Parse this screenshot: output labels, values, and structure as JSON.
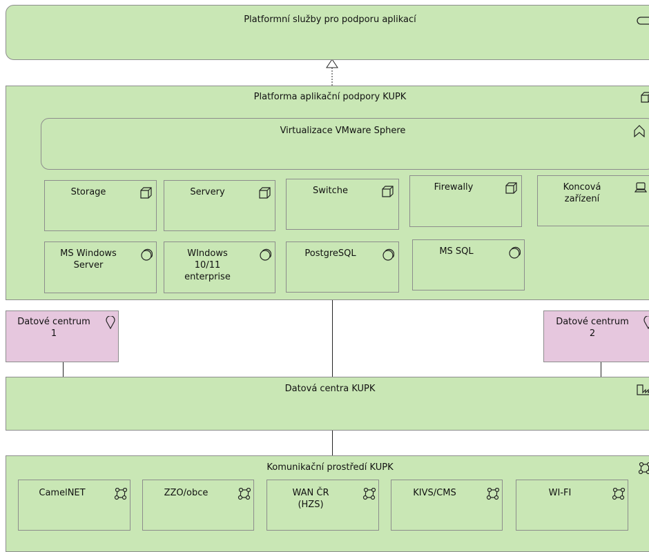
{
  "colors": {
    "green_fill": "#c9e7b5",
    "pink_fill": "#e6c7de",
    "border": "#8c8c8c"
  },
  "platform_services": {
    "label": "Platformní služby pro podporu aplikací",
    "icon": "service-icon"
  },
  "platform_node": {
    "label": "Platforma aplikační podpory KUPK",
    "icon": "node-icon"
  },
  "virtualization": {
    "label": "Virtualizace VMware Sphere",
    "icon": "function-icon"
  },
  "devices": [
    {
      "label": "Storage",
      "icon": "node-icon"
    },
    {
      "label": "Servery",
      "icon": "node-icon"
    },
    {
      "label": "Switche",
      "icon": "node-icon"
    },
    {
      "label": "Firewally",
      "icon": "node-icon"
    },
    {
      "label": "Koncová\nzařízení",
      "icon": "device-icon"
    }
  ],
  "software": [
    {
      "label": "MS Windows\nServer",
      "icon": "system-software-icon"
    },
    {
      "label": "WIndows\n10/11\nenterprise",
      "icon": "system-software-icon"
    },
    {
      "label": "PostgreSQL",
      "icon": "system-software-icon"
    },
    {
      "label": "MS SQL",
      "icon": "system-software-icon"
    }
  ],
  "locations": [
    {
      "label": "Datové centrum\n1",
      "icon": "location-icon"
    },
    {
      "label": "Datové centrum\n2",
      "icon": "location-icon"
    }
  ],
  "datacenters": {
    "label": "Datová centra KUPK",
    "icon": "facility-icon"
  },
  "communication": {
    "label": "Komunikační prostředí KUPK",
    "icon": "network-icon",
    "networks": [
      {
        "label": "CamelNET",
        "icon": "network-icon"
      },
      {
        "label": "ZZO/obce",
        "icon": "network-icon"
      },
      {
        "label": "WAN ČR\n(HZS)",
        "icon": "network-icon"
      },
      {
        "label": "KIVS/CMS",
        "icon": "network-icon"
      },
      {
        "label": "WI-FI",
        "icon": "network-icon"
      }
    ]
  }
}
